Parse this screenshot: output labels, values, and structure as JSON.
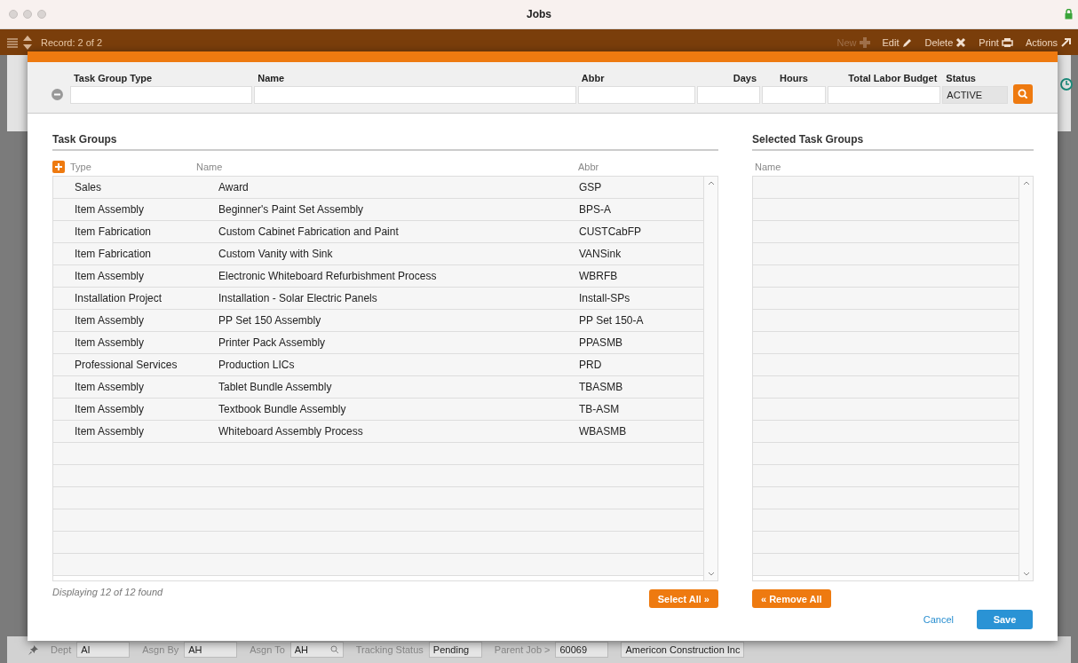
{
  "window": {
    "title": "Jobs"
  },
  "toolbar": {
    "record": "Record: 2 of 2",
    "actions": [
      {
        "label": "New",
        "disabled": true
      },
      {
        "label": "Edit",
        "disabled": false
      },
      {
        "label": "Delete",
        "disabled": false
      },
      {
        "label": "Print",
        "disabled": false
      },
      {
        "label": "Actions",
        "disabled": false
      }
    ]
  },
  "filter": {
    "fields": [
      {
        "label": "Task Group Type"
      },
      {
        "label": "Name"
      },
      {
        "label": "Abbr"
      },
      {
        "label": "Days"
      },
      {
        "label": "Hours"
      },
      {
        "label": "Total Labor Budget"
      },
      {
        "label": "Status",
        "value": "ACTIVE"
      }
    ]
  },
  "task_groups": {
    "title": "Task Groups",
    "columns": [
      "Type",
      "Name",
      "Abbr"
    ],
    "rows": [
      [
        "Sales",
        "Award",
        "GSP"
      ],
      [
        "Item Assembly",
        "Beginner's Paint Set Assembly",
        "BPS-A"
      ],
      [
        "Item Fabrication",
        "Custom Cabinet Fabrication and Paint",
        "CUSTCabFP"
      ],
      [
        "Item Fabrication",
        "Custom Vanity with Sink",
        "VANSink"
      ],
      [
        "Item Assembly",
        "Electronic Whiteboard Refurbishment Process",
        "WBRFB"
      ],
      [
        "Installation Project",
        "Installation - Solar Electric Panels",
        "Install-SPs"
      ],
      [
        "Item Assembly",
        "PP Set 150 Assembly",
        "PP Set 150-A"
      ],
      [
        "Item Assembly",
        "Printer Pack Assembly",
        "PPASMB"
      ],
      [
        "Professional Services",
        "Production LICs",
        "PRD"
      ],
      [
        "Item Assembly",
        "Tablet Bundle Assembly",
        "TBASMB"
      ],
      [
        "Item Assembly",
        "Textbook Bundle Assembly",
        "TB-ASM"
      ],
      [
        "Item Assembly",
        "Whiteboard Assembly Process",
        "WBASMB"
      ]
    ],
    "footer": "Displaying 12 of 12 found",
    "button": "Select All »"
  },
  "selected_task_groups": {
    "title": "Selected Task Groups",
    "columns": [
      "Name"
    ],
    "button": "« Remove All"
  },
  "dialog_buttons": {
    "cancel": "Cancel",
    "save": "Save"
  },
  "status_bar": [
    {
      "label": "Dept",
      "values": [
        "AI"
      ],
      "search": false
    },
    {
      "label": "Asgn By",
      "values": [
        "AH"
      ],
      "search": false
    },
    {
      "label": "Asgn To",
      "values": [
        "AH"
      ],
      "search": true
    },
    {
      "label": "Tracking Status",
      "values": [
        "Pending"
      ],
      "search": false
    },
    {
      "label": "Parent Job >",
      "values": [
        "60069",
        "Americon Construction Inc"
      ],
      "search": false
    }
  ]
}
